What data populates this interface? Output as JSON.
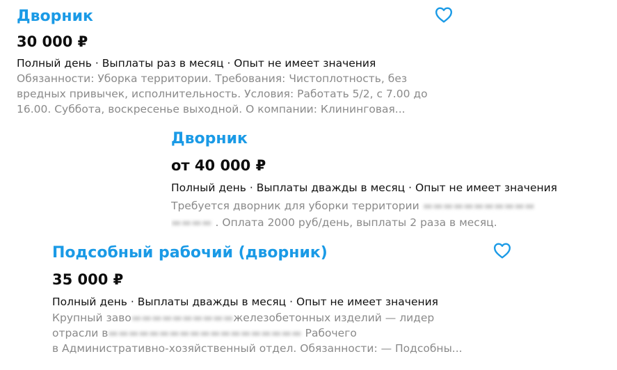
{
  "accent_color": "#1a9ae6",
  "vacancies": [
    {
      "title": "Дворник",
      "price": "30 000 ₽",
      "meta": "Полный день · Выплаты раз в месяц · Опыт не имеет значения",
      "desc_lines": [
        "Обязанности: Уборка территории. Требования: Чистоплотность, без",
        "вредных привычек, исполнительность. Условия: Работать 5/2, с 7.00 до",
        "16.00. Суббота, воскресенье выходной. О компании: Клининговая..."
      ],
      "favorite_icon": "heart-outline-icon"
    },
    {
      "title": "Дворник",
      "price": "от 40 000 ₽",
      "meta": "Полный день · Выплаты дважды в месяц · Опыт не имеет значения",
      "desc_lines": [
        "Требуется дворник для уборки территории",
        ". Оплата 2000 руб/день, выплаты 2 раза в месяц."
      ]
    },
    {
      "title": "Подсобный рабочий (дворник)",
      "price": "35 000 ₽",
      "meta": "Полный день · Выплаты дважды в месяц · Опыт не имеет значения",
      "desc_lines": [
        "Крупный заво",
        "железобетонных изделий — лидер",
        "отрасли в",
        "Рабочего",
        "в Административно-хозяйственный отдел. Обязанности: — Подсобны..."
      ],
      "favorite_icon": "heart-outline-icon"
    }
  ]
}
